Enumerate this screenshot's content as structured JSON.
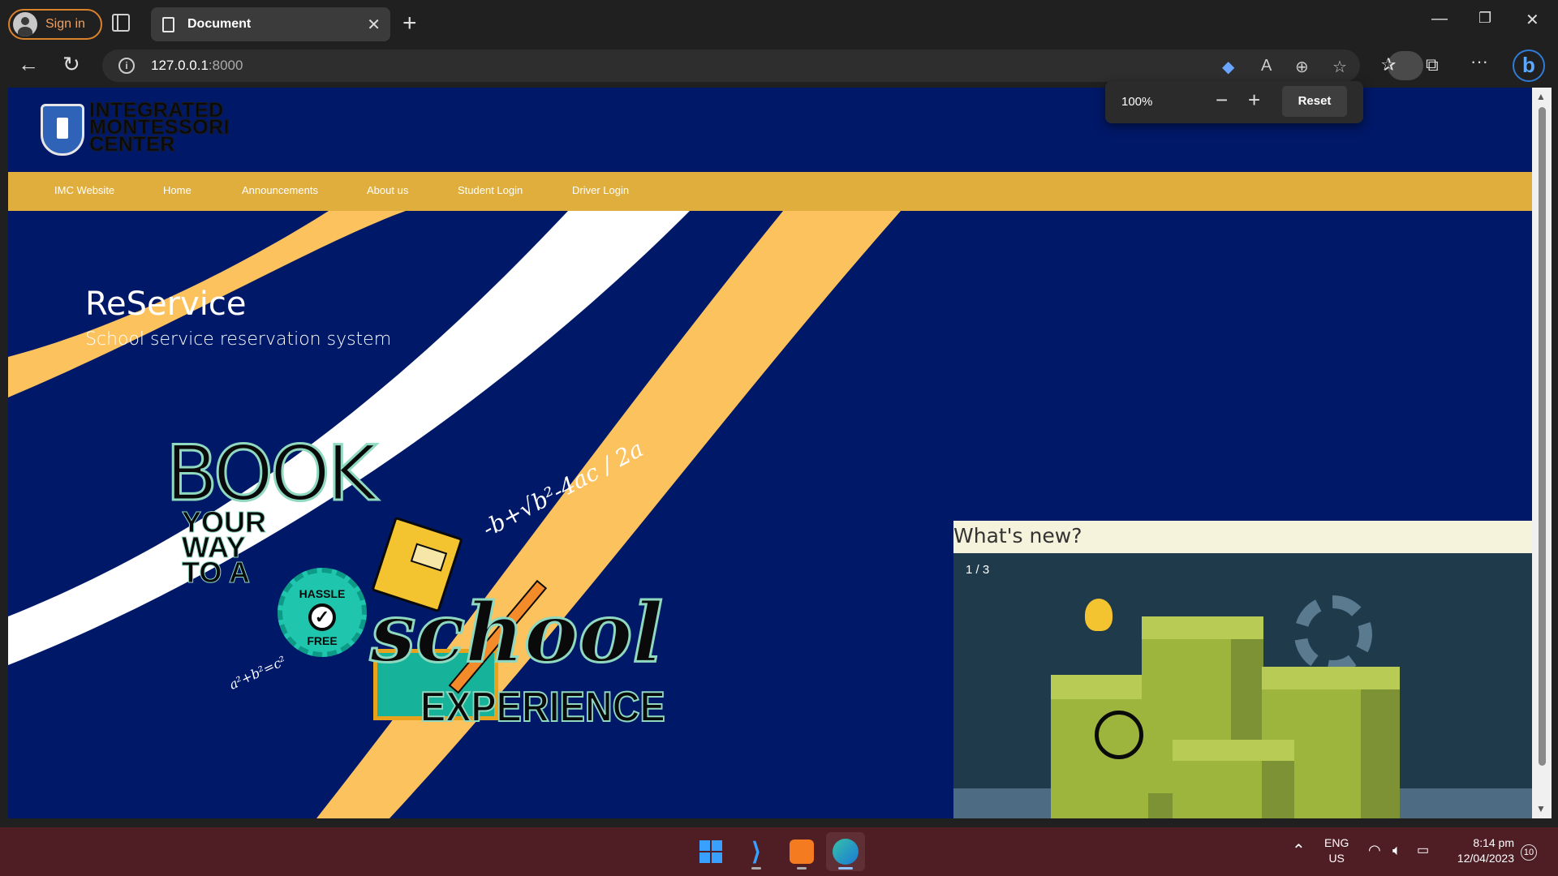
{
  "browser": {
    "signin_label": "Sign in",
    "tab_title": "Document",
    "url_host": "127.0.0.1",
    "url_port": ":8000"
  },
  "zoom_popup": {
    "percent": "100%",
    "reset_label": "Reset"
  },
  "site": {
    "logo_lines": [
      "INTEGRATED",
      "MONTESSORI",
      "CENTER"
    ],
    "nav": [
      "IMC Website",
      "Home",
      "Announcements",
      "About us",
      "Student Login",
      "Driver Login"
    ],
    "hero_title": "ReService",
    "hero_subtitle": "School service reservation system",
    "banner": {
      "book": "BOOK",
      "your_way": [
        "YOUR",
        "WAY",
        "TO A"
      ],
      "hassle": "HASSLE",
      "free": "FREE",
      "school": "school",
      "experience": "EXPERIENCE",
      "formula": "-b+√b²-4ac",
      "formula_den": "2a",
      "pythag": "a²+b²=c²"
    },
    "whats_new": {
      "title": "What's new?",
      "counter": "1 / 3",
      "slide_count": 3,
      "active_slide": 0
    }
  },
  "colors": {
    "page_bg": "#001868",
    "nav_bg": "#dfae3d",
    "stripe_yellow": "#fcc25d",
    "stripe_white": "#ffffff",
    "panel_bg": "#f5f3dc"
  },
  "taskbar": {
    "apps": [
      "windows-start",
      "vscode",
      "xampp",
      "edge"
    ],
    "lang_top": "ENG",
    "lang_bottom": "US",
    "time": "8:14 pm",
    "date": "12/04/2023",
    "notifications": "10"
  }
}
